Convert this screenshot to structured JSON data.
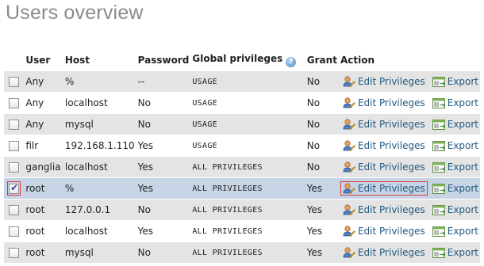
{
  "page": {
    "title": "Users overview"
  },
  "table": {
    "headers": {
      "user": "User",
      "host": "Host",
      "password": "Password",
      "global_privileges": "Global privileges",
      "grant": "Grant",
      "action": "Action"
    },
    "actions": {
      "edit": "Edit Privileges",
      "export": "Export"
    },
    "rows": [
      {
        "user": "Any",
        "host": "%",
        "password": "--",
        "privileges": "USAGE",
        "grant": "No",
        "checked": false
      },
      {
        "user": "Any",
        "host": "localhost",
        "password": "No",
        "privileges": "USAGE",
        "grant": "No",
        "checked": false
      },
      {
        "user": "Any",
        "host": "mysql",
        "password": "No",
        "privileges": "USAGE",
        "grant": "No",
        "checked": false
      },
      {
        "user": "filr",
        "host": "192.168.1.110",
        "password": "Yes",
        "privileges": "USAGE",
        "grant": "No",
        "checked": false
      },
      {
        "user": "ganglia",
        "host": "localhost",
        "password": "Yes",
        "privileges": "ALL PRIVILEGES",
        "grant": "No",
        "checked": false
      },
      {
        "user": "root",
        "host": "%",
        "password": "Yes",
        "privileges": "ALL PRIVILEGES",
        "grant": "Yes",
        "checked": true
      },
      {
        "user": "root",
        "host": "127.0.0.1",
        "password": "No",
        "privileges": "ALL PRIVILEGES",
        "grant": "Yes",
        "checked": false
      },
      {
        "user": "root",
        "host": "localhost",
        "password": "Yes",
        "privileges": "ALL PRIVILEGES",
        "grant": "Yes",
        "checked": false
      },
      {
        "user": "root",
        "host": "mysql",
        "password": "No",
        "privileges": "ALL PRIVILEGES",
        "grant": "Yes",
        "checked": false
      }
    ]
  },
  "colors": {
    "accent_red": "#d40000",
    "link": "#235a81",
    "selected_row": "#c7d4e6",
    "stripe": "#e4e4e4"
  }
}
